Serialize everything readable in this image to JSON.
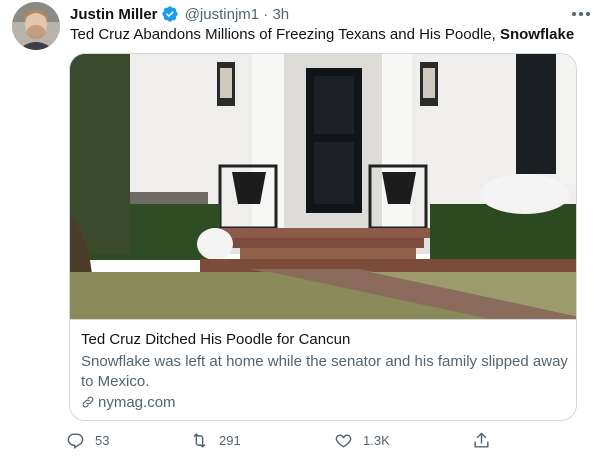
{
  "tweet": {
    "author_name": "Justin Miller",
    "handle": "@justinjm1",
    "separator": "·",
    "time": "3h",
    "text_prefix": "Ted Cruz Abandons Millions of Freezing Texans and His Poodle, ",
    "text_bold": "Snowflake"
  },
  "card": {
    "title": "Ted Cruz Ditched His Poodle for Cancun",
    "description": "Snowflake was left at home while the senator and his family slipped away to Mexico.",
    "domain": "nymag.com"
  },
  "actions": {
    "reply_count": "53",
    "retweet_count": "291",
    "like_count": "1.3K"
  },
  "colors": {
    "verified": "#1d9bf0",
    "secondary_text": "#536471",
    "border": "#cfd9de"
  },
  "icons": [
    "verified-badge-icon",
    "more-icon",
    "link-icon",
    "reply-icon",
    "retweet-icon",
    "like-icon",
    "share-icon"
  ]
}
